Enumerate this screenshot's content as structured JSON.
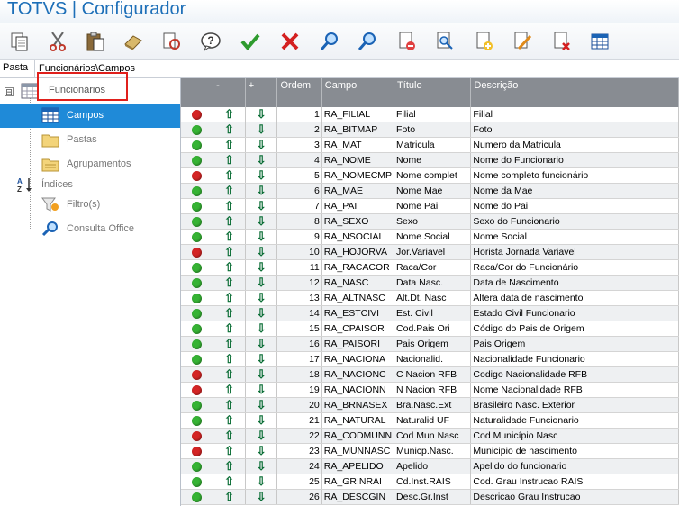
{
  "app": {
    "title": "TOTVS | Configurador"
  },
  "toolbar": {
    "buttons": [
      {
        "icon": "copy-icon"
      },
      {
        "icon": "cut-icon"
      },
      {
        "icon": "paste-icon"
      },
      {
        "icon": "eraser-icon"
      },
      {
        "icon": "refresh-document-icon"
      },
      {
        "icon": "help-icon"
      },
      {
        "icon": "confirm-check-icon"
      },
      {
        "icon": "cancel-x-icon"
      },
      {
        "icon": "search-icon"
      },
      {
        "icon": "search-next-icon"
      },
      {
        "icon": "document-remove-icon"
      },
      {
        "icon": "document-preview-icon"
      },
      {
        "icon": "document-add-icon"
      },
      {
        "icon": "document-edit-icon"
      },
      {
        "icon": "document-delete-icon"
      },
      {
        "icon": "table-view-icon"
      }
    ]
  },
  "pathbar": {
    "label": "Pasta",
    "path": "Funcionários\\Campos"
  },
  "tree": {
    "root": {
      "label": "Funcionários",
      "expander": "⊟"
    },
    "items": [
      {
        "label": "Campos",
        "icon": "table-icon",
        "selected": true
      },
      {
        "label": "Pastas",
        "icon": "folder-icon"
      },
      {
        "label": "Agrupamentos",
        "icon": "folder-group-icon"
      },
      {
        "label": "Índices",
        "icon": "sort-az-icon"
      },
      {
        "label": "Filtro(s)",
        "icon": "filter-icon"
      },
      {
        "label": "Consulta Office",
        "icon": "search-icon"
      }
    ]
  },
  "grid": {
    "columns": [
      "",
      "-",
      "+",
      "Ordem",
      "Campo",
      "Título",
      "Descrição"
    ],
    "colors": {
      "red": "#d42424",
      "green": "#36b334"
    },
    "rows": [
      {
        "status": "red",
        "up": "⇧",
        "down": "⇩",
        "ordem": "1",
        "campo": "RA_FILIAL",
        "titulo": "Filial",
        "descricao": "Filial"
      },
      {
        "status": "green",
        "up": "⇧",
        "down": "⇩",
        "ordem": "2",
        "campo": "RA_BITMAP",
        "titulo": "Foto",
        "descricao": "Foto"
      },
      {
        "status": "green",
        "up": "⇧",
        "down": "⇩",
        "ordem": "3",
        "campo": "RA_MAT",
        "titulo": "Matricula",
        "descricao": "Numero da Matricula"
      },
      {
        "status": "green",
        "up": "⇧",
        "down": "⇩",
        "ordem": "4",
        "campo": "RA_NOME",
        "titulo": "Nome",
        "descricao": "Nome do Funcionario"
      },
      {
        "status": "red",
        "up": "⇧",
        "down": "⇩",
        "ordem": "5",
        "campo": "RA_NOMECMP",
        "titulo": "Nome complet",
        "descricao": "Nome completo funcionário"
      },
      {
        "status": "green",
        "up": "⇧",
        "down": "⇩",
        "ordem": "6",
        "campo": "RA_MAE",
        "titulo": "Nome Mae",
        "descricao": "Nome da Mae"
      },
      {
        "status": "green",
        "up": "⇧",
        "down": "⇩",
        "ordem": "7",
        "campo": "RA_PAI",
        "titulo": "Nome Pai",
        "descricao": "Nome do Pai"
      },
      {
        "status": "green",
        "up": "⇧",
        "down": "⇩",
        "ordem": "8",
        "campo": "RA_SEXO",
        "titulo": "Sexo",
        "descricao": "Sexo do Funcionario"
      },
      {
        "status": "green",
        "up": "⇧",
        "down": "⇩",
        "ordem": "9",
        "campo": "RA_NSOCIAL",
        "titulo": "Nome Social",
        "descricao": "Nome Social"
      },
      {
        "status": "red",
        "up": "⇧",
        "down": "⇩",
        "ordem": "10",
        "campo": "RA_HOJORVA",
        "titulo": "Jor.Variavel",
        "descricao": "Horista Jornada Variavel"
      },
      {
        "status": "green",
        "up": "⇧",
        "down": "⇩",
        "ordem": "11",
        "campo": "RA_RACACOR",
        "titulo": "Raca/Cor",
        "descricao": "Raca/Cor do Funcionário"
      },
      {
        "status": "green",
        "up": "⇧",
        "down": "⇩",
        "ordem": "12",
        "campo": "RA_NASC",
        "titulo": "Data Nasc.",
        "descricao": "Data  de Nascimento"
      },
      {
        "status": "green",
        "up": "⇧",
        "down": "⇩",
        "ordem": "13",
        "campo": "RA_ALTNASC",
        "titulo": "Alt.Dt. Nasc",
        "descricao": "Altera data de nascimento"
      },
      {
        "status": "green",
        "up": "⇧",
        "down": "⇩",
        "ordem": "14",
        "campo": "RA_ESTCIVI",
        "titulo": "Est. Civil",
        "descricao": "Estado Civil Funcionario"
      },
      {
        "status": "green",
        "up": "⇧",
        "down": "⇩",
        "ordem": "15",
        "campo": "RA_CPAISOR",
        "titulo": "Cod.Pais Ori",
        "descricao": "Código do Pais de Origem"
      },
      {
        "status": "green",
        "up": "⇧",
        "down": "⇩",
        "ordem": "16",
        "campo": "RA_PAISORI",
        "titulo": "Pais Origem",
        "descricao": "Pais Origem"
      },
      {
        "status": "green",
        "up": "⇧",
        "down": "⇩",
        "ordem": "17",
        "campo": "RA_NACIONA",
        "titulo": "Nacionalid.",
        "descricao": "Nacionalidade Funcionario"
      },
      {
        "status": "red",
        "up": "⇧",
        "down": "⇩",
        "ordem": "18",
        "campo": "RA_NACIONC",
        "titulo": "C Nacion RFB",
        "descricao": "Codigo Nacionalidade RFB"
      },
      {
        "status": "red",
        "up": "⇧",
        "down": "⇩",
        "ordem": "19",
        "campo": "RA_NACIONN",
        "titulo": "N Nacion RFB",
        "descricao": "Nome Nacionalidade RFB"
      },
      {
        "status": "green",
        "up": "⇧",
        "down": "⇩",
        "ordem": "20",
        "campo": "RA_BRNASEX",
        "titulo": "Bra.Nasc.Ext",
        "descricao": "Brasileiro Nasc. Exterior"
      },
      {
        "status": "green",
        "up": "⇧",
        "down": "⇩",
        "ordem": "21",
        "campo": "RA_NATURAL",
        "titulo": "Naturalid UF",
        "descricao": "Naturalidade Funcionario"
      },
      {
        "status": "red",
        "up": "⇧",
        "down": "⇩",
        "ordem": "22",
        "campo": "RA_CODMUNN",
        "titulo": "Cod Mun Nasc",
        "descricao": "Cod Município Nasc"
      },
      {
        "status": "red",
        "up": "⇧",
        "down": "⇩",
        "ordem": "23",
        "campo": "RA_MUNNASC",
        "titulo": "Municp.Nasc.",
        "descricao": "Municipio de nascimento"
      },
      {
        "status": "green",
        "up": "⇧",
        "down": "⇩",
        "ordem": "24",
        "campo": "RA_APELIDO",
        "titulo": "Apelido",
        "descricao": "Apelido do funcionario"
      },
      {
        "status": "green",
        "up": "⇧",
        "down": "⇩",
        "ordem": "25",
        "campo": "RA_GRINRAI",
        "titulo": "Cd.Inst.RAIS",
        "descricao": "Cod. Grau Instrucao RAIS"
      },
      {
        "status": "green",
        "up": "⇧",
        "down": "⇩",
        "ordem": "26",
        "campo": "RA_DESCGIN",
        "titulo": "Desc.Gr.Inst",
        "descricao": "Descricao Grau Instrucao"
      }
    ]
  }
}
